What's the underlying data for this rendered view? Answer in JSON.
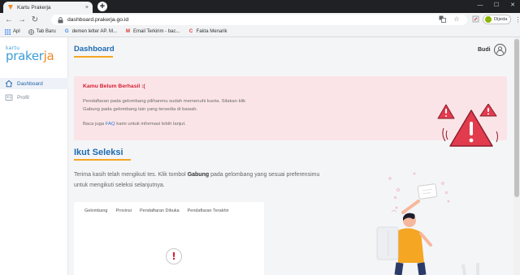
{
  "browser": {
    "tab_title": "Kartu Prakerja",
    "tab_close": "×",
    "new_tab": "+",
    "url": "dashboard.prakerja.go.id",
    "profile_name": "Dijeda",
    "bookmarks": [
      {
        "label": "Apl",
        "icon": "apps-grid-icon",
        "color": "#4285f4"
      },
      {
        "label": "Tab Baru",
        "icon": "globe-icon",
        "color": "#5f6368"
      },
      {
        "label": "demen letter AP. M...",
        "icon": "google-icon",
        "color": "#4285f4"
      },
      {
        "label": "Email Terkirim - bac...",
        "icon": "gmail-icon",
        "color": "#d93025"
      },
      {
        "label": "Fakta Menarik",
        "icon": "c-logo-icon",
        "color": "#e53935"
      }
    ]
  },
  "app": {
    "logo_small": "kartu",
    "logo_main": "prakerja",
    "colors": {
      "primary": "#1d6ab1",
      "accent": "#f5a623",
      "danger": "#d21f35",
      "alert_bg": "#fbe4e7"
    },
    "sidebar": {
      "items": [
        {
          "label": "Dashboard",
          "icon": "home-icon",
          "active": true
        },
        {
          "label": "Profil",
          "icon": "profile-card-icon",
          "active": false
        }
      ]
    },
    "header": {
      "title": "Dashboard",
      "user_name": "Budi"
    },
    "alert": {
      "title": "Kamu Belum Berhasil :(",
      "body_line1": "Pendaftaran pada gelombang pilihanmu sudah memenuhi kuota. Silakan klik",
      "body_line2": "Gabung pada gelombang lain yang tersedia di bawah.",
      "faq_prefix": "Baca juga",
      "faq_link": "FAQ",
      "faq_suffix": "kami untuk informasi lebih lanjut."
    },
    "section": {
      "title": "Ikut Seleksi",
      "desc_prefix": "Terima kasih telah mengikuti tes. Klik tombol",
      "desc_bold": "Gabung",
      "desc_suffix": "pada gelombang yang sesuai preferensimu untuk mengikuti seleksi selanjutnya."
    },
    "table": {
      "headers": [
        "Gelombang",
        "Provinsi",
        "Pendaftaran Dibuka",
        "Pendaftaran Terakhir"
      ],
      "empty_icon": "warning-icon",
      "empty_mark": "!"
    }
  }
}
